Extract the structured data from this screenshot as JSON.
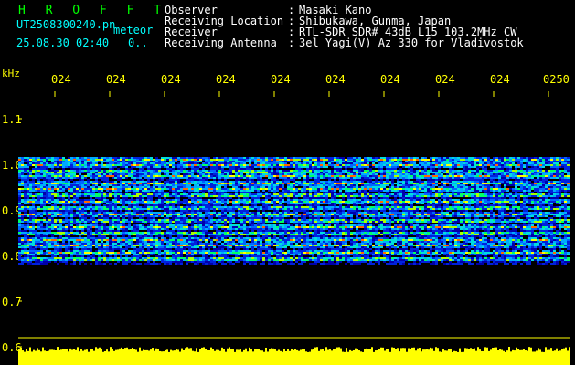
{
  "brand": "H R O F F T",
  "file_name": "UT2508300240.pn",
  "meteor_label": "meteor",
  "datetime": "25.08.30 02:40",
  "counter": "0..",
  "info": [
    {
      "label": "Observer",
      "value": "Masaki Kano"
    },
    {
      "label": "Receiving Location",
      "value": "Shibukawa, Gunma, Japan"
    },
    {
      "label": "Receiver",
      "value": "RTL-SDR SDR# 43dB L15 103.2MHz CW"
    },
    {
      "label": "Receiving Antenna",
      "value": "3el Yagi(V) Az 330 for Vladivostok"
    }
  ],
  "colon": ":",
  "y_unit": "kHz",
  "x_ticks": [
    "024",
    "024",
    "024",
    "024",
    "024",
    "024",
    "024",
    "024",
    "024",
    "0250"
  ],
  "y_ticks": [
    "1.1",
    "1.0",
    "0.9",
    "0.8",
    "0.7",
    "0.6"
  ],
  "colors": {
    "background": "#000000",
    "axis": "#ffff00",
    "header_label": "#00ffff",
    "brand": "#00ff00",
    "signal_bar": "#ffff00"
  }
}
